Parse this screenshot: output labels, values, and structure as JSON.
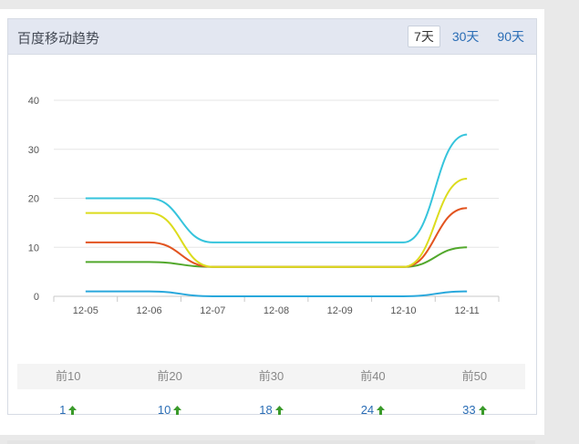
{
  "card": {
    "title": "百度移动趋势",
    "range_tabs": [
      {
        "label": "7天",
        "active": true
      },
      {
        "label": "30天",
        "active": false
      },
      {
        "label": "90天",
        "active": false
      }
    ]
  },
  "chart_data": {
    "type": "line",
    "categories": [
      "12-05",
      "12-06",
      "12-07",
      "12-08",
      "12-09",
      "12-10",
      "12-11"
    ],
    "ylim": [
      0,
      40
    ],
    "yticks": [
      0,
      10,
      20,
      30,
      40
    ],
    "grid": true,
    "legend_position": "bottom",
    "series": [
      {
        "name": "前10名",
        "color": "#29a8dc",
        "values": [
          1,
          1,
          0,
          0,
          0,
          0,
          1
        ]
      },
      {
        "name": "前20名",
        "color": "#52a82c",
        "values": [
          7,
          7,
          6,
          6,
          6,
          6,
          10
        ]
      },
      {
        "name": "前30名",
        "color": "#e25420",
        "values": [
          11,
          11,
          6,
          6,
          6,
          6,
          18
        ]
      },
      {
        "name": "前40名",
        "color": "#dcdc1e",
        "values": [
          17,
          17,
          6,
          6,
          6,
          6,
          24
        ]
      },
      {
        "name": "前50名",
        "color": "#36c4dc",
        "values": [
          20,
          20,
          11,
          11,
          11,
          11,
          33
        ]
      }
    ]
  },
  "stats": {
    "headers": [
      "前10",
      "前20",
      "前30",
      "前40",
      "前50"
    ],
    "values": [
      "1",
      "10",
      "18",
      "24",
      "33"
    ]
  },
  "colors": {
    "trend_up": "#3a9a2a",
    "link": "#2a6db5"
  }
}
